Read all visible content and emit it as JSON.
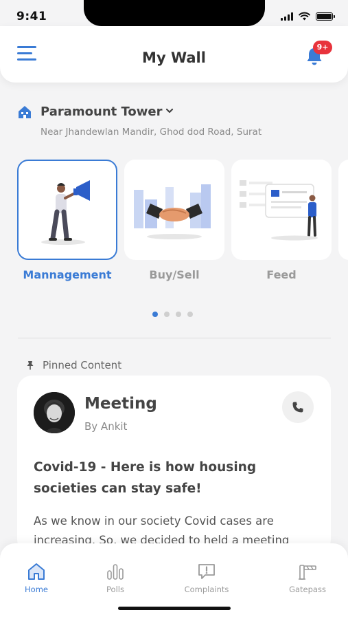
{
  "status_bar": {
    "time": "9:41"
  },
  "header": {
    "title": "My Wall",
    "notification_badge": "9+"
  },
  "location": {
    "name": "Paramount Tower",
    "address": "Near Jhandewlan Mandir, Ghod dod Road, Surat"
  },
  "categories": [
    {
      "label": "Mannagement",
      "active": true,
      "icon": "megaphone-person-illustration"
    },
    {
      "label": "Buy/Sell",
      "active": false,
      "icon": "handshake-illustration"
    },
    {
      "label": "Feed",
      "active": false,
      "icon": "feed-board-illustration"
    }
  ],
  "carousel": {
    "pages": 4,
    "current": 1
  },
  "pinned": {
    "section_label": "Pinned Content",
    "post": {
      "title": "Meeting",
      "author": "By Ankit",
      "heading": "Covid-19 - Here is how housing societies can stay safe!",
      "body": "As we know in our society Covid cases are increasing. So, we decided to held a meeting"
    }
  },
  "tabs": [
    {
      "label": "Home",
      "icon": "home-icon",
      "active": true
    },
    {
      "label": "Polls",
      "icon": "polls-icon",
      "active": false
    },
    {
      "label": "Complaints",
      "icon": "complaint-icon",
      "active": false
    },
    {
      "label": "Gatepass",
      "icon": "gatepass-icon",
      "active": false
    }
  ],
  "colors": {
    "accent": "#3a7bd5",
    "badge": "#e8333c",
    "background": "#f4f4f5"
  }
}
